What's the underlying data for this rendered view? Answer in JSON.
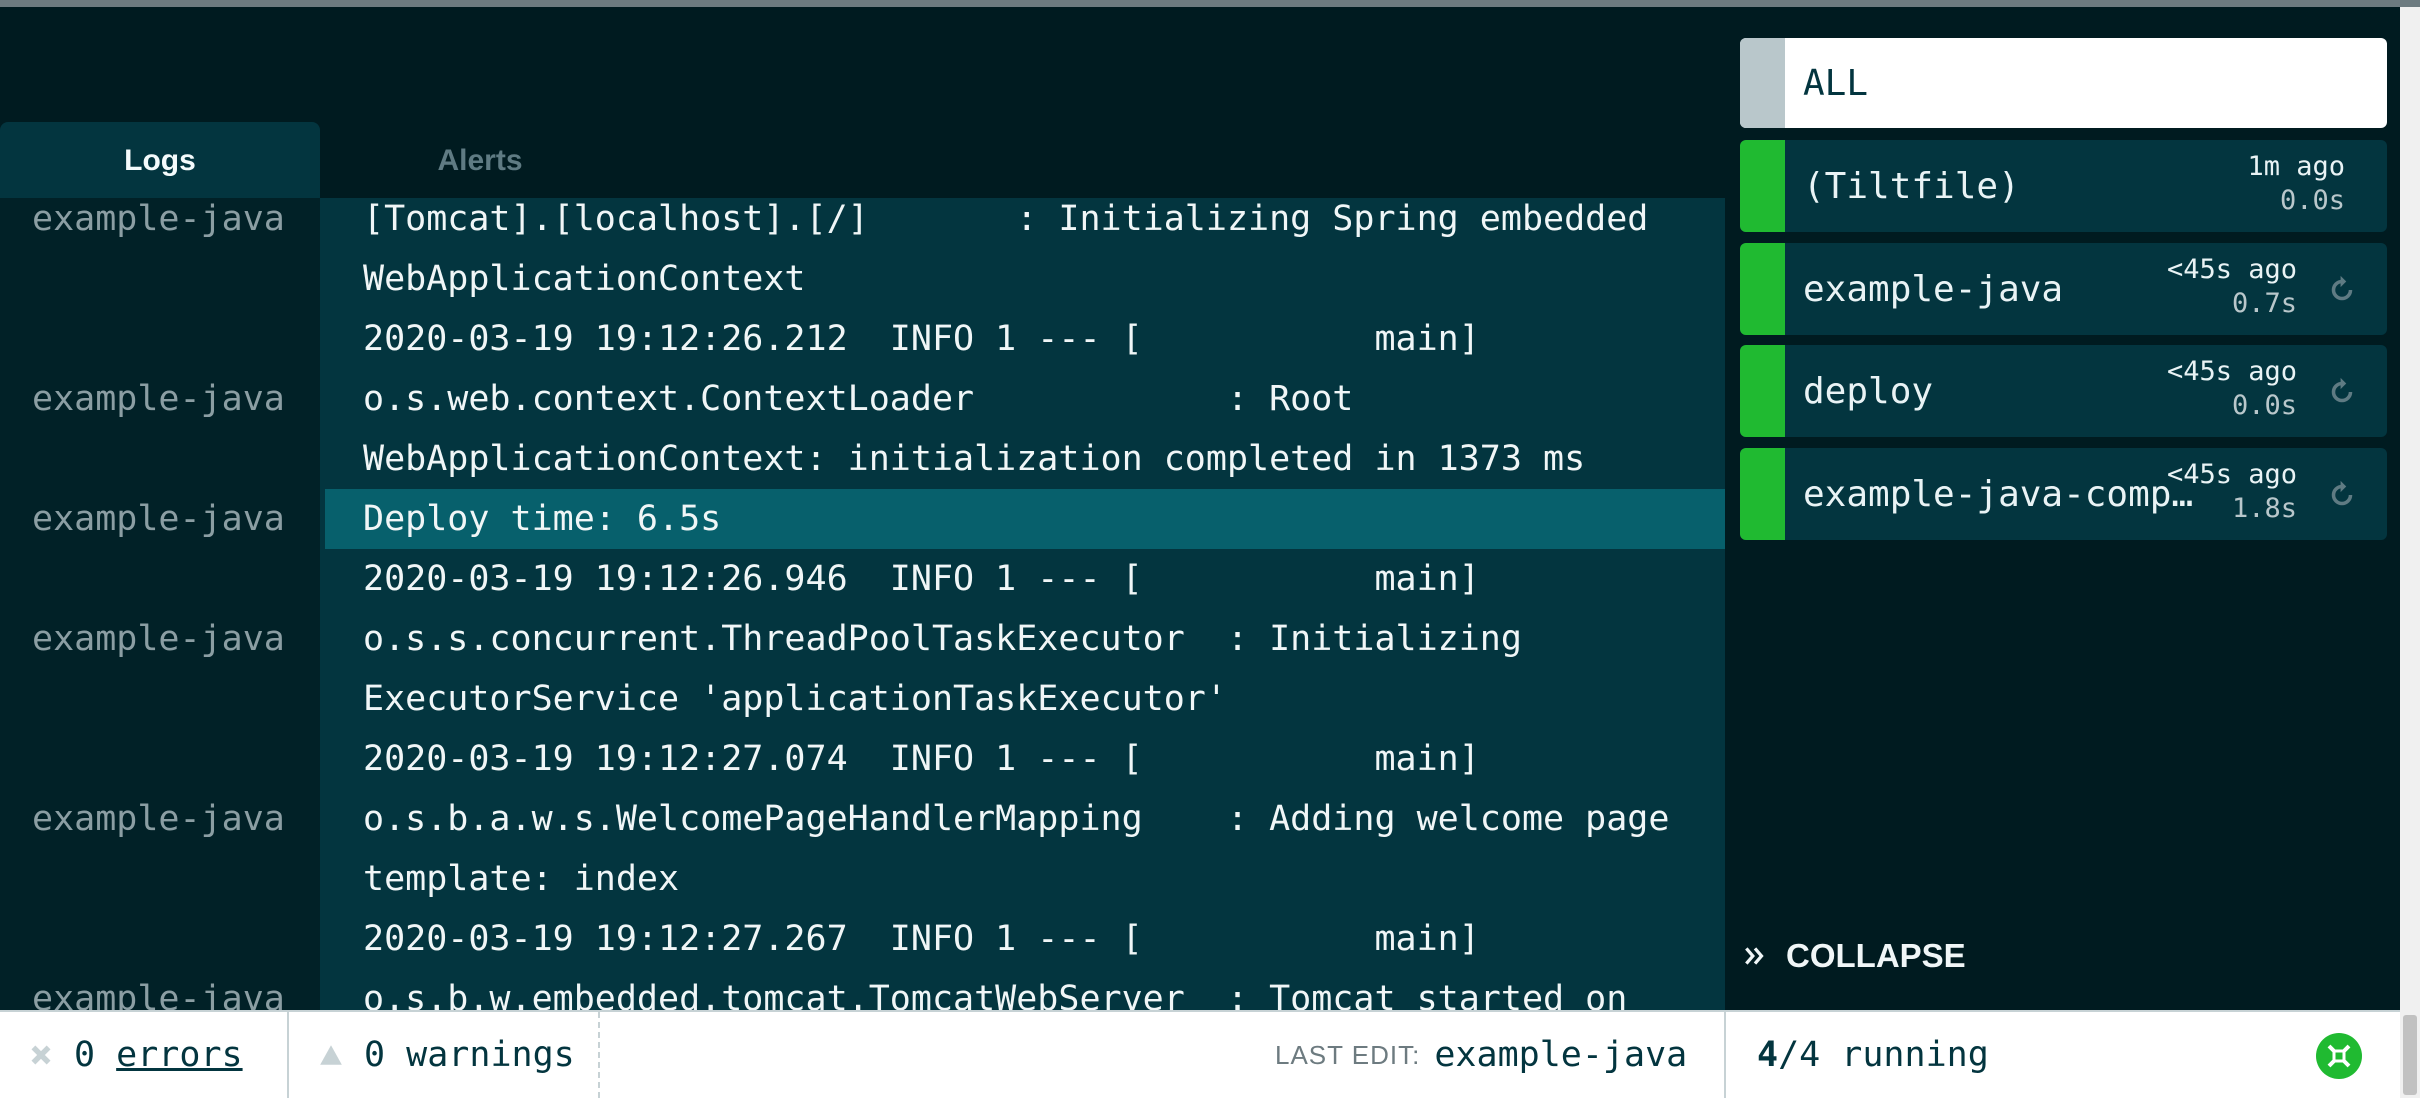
{
  "tabs": [
    {
      "label": "Logs"
    },
    {
      "label": "Alerts"
    }
  ],
  "log_lines": [
    {
      "source": "example-java",
      "text": "[Tomcat].[localhost].[/]       : Initializing Spring embedded"
    },
    {
      "source": "",
      "text": "WebApplicationContext"
    },
    {
      "source": "",
      "text": "2020-03-19 19:12:26.212  INFO 1 --- [           main]"
    },
    {
      "source": "example-java",
      "text": "o.s.web.context.ContextLoader            : Root"
    },
    {
      "source": "",
      "text": "WebApplicationContext: initialization completed in 1373 ms"
    },
    {
      "source": "example-java",
      "text": "Deploy time: 6.5s"
    },
    {
      "source": "",
      "text": "2020-03-19 19:12:26.946  INFO 1 --- [           main]"
    },
    {
      "source": "example-java",
      "text": "o.s.s.concurrent.ThreadPoolTaskExecutor  : Initializing"
    },
    {
      "source": "",
      "text": "ExecutorService 'applicationTaskExecutor'"
    },
    {
      "source": "",
      "text": "2020-03-19 19:12:27.074  INFO 1 --- [           main]"
    },
    {
      "source": "example-java",
      "text": "o.s.b.a.w.s.WelcomePageHandlerMapping    : Adding welcome page"
    },
    {
      "source": "",
      "text": "template: index"
    },
    {
      "source": "",
      "text": "2020-03-19 19:12:27.267  INFO 1 --- [           main]"
    },
    {
      "source": "example-java",
      "text": "o.s.b.w.embedded.tomcat.TomcatWebServer  : Tomcat started on"
    }
  ],
  "sidebar": {
    "all_label": "ALL",
    "resources": [
      {
        "name": "(Tiltfile)",
        "ago": "1m ago",
        "duration": "0.0s",
        "status": "ok"
      },
      {
        "name": "example-java",
        "ago": "<45s ago",
        "duration": "0.7s",
        "status": "ok"
      },
      {
        "name": "deploy",
        "ago": "<45s ago",
        "duration": "0.0s",
        "status": "ok"
      },
      {
        "name": "example-java-comp…",
        "ago": "<45s ago",
        "duration": "1.8s",
        "status": "ok"
      }
    ],
    "collapse_label": "COLLAPSE"
  },
  "statusbar": {
    "errors_count": "0",
    "errors_label": "errors",
    "warnings_count": "0",
    "warnings_label": "warnings",
    "last_edit_label": "LAST EDIT:",
    "last_edit_value": "example-java",
    "running_count": "4",
    "running_total": "/4 running"
  },
  "colors": {
    "status_ok": "#20ba31",
    "background": "#001b20",
    "log_background": "#03353f",
    "highlight": "#07606c"
  }
}
